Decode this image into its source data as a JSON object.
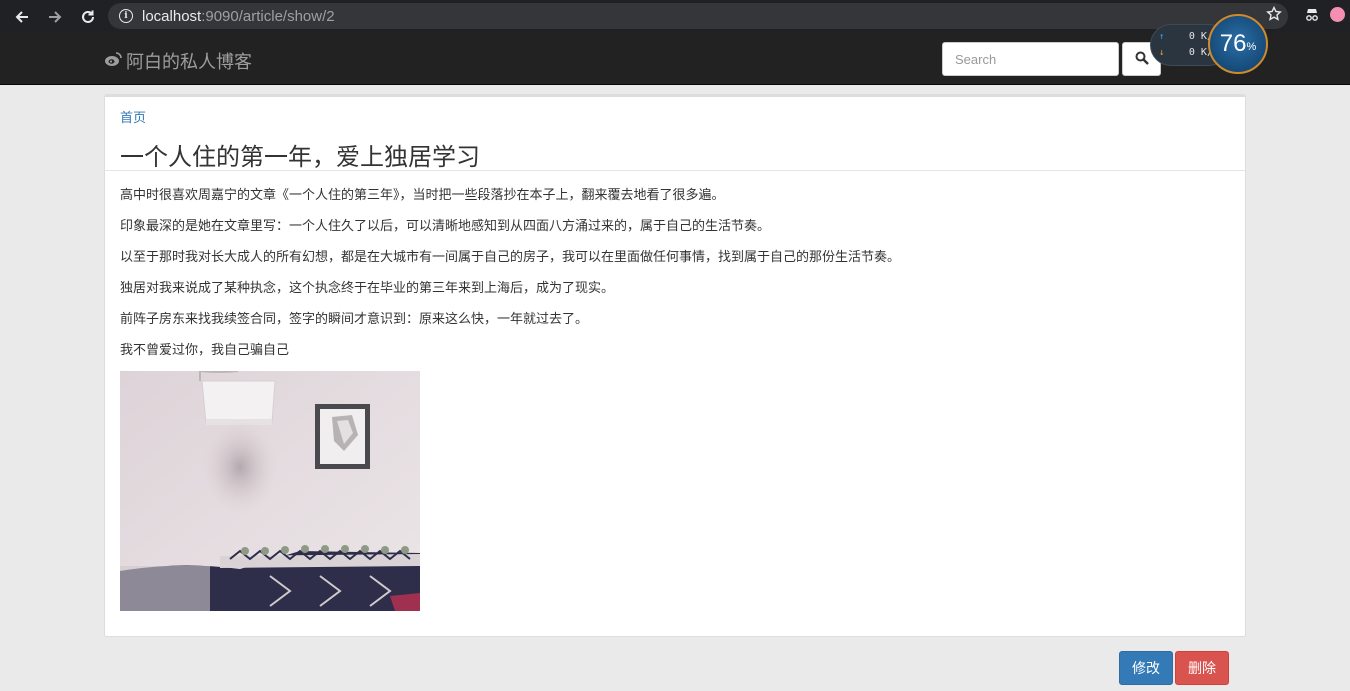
{
  "browser": {
    "url_host": "localhost",
    "url_rest": ":9090/article/show/2"
  },
  "navbar": {
    "brand": "阿白的私人博客",
    "search_placeholder": "Search"
  },
  "speed_widget": {
    "up": "0 K/s",
    "down": "0 K/s",
    "percent_num": "76",
    "percent_sign": "%"
  },
  "article": {
    "breadcrumb": "首页",
    "title": "一个人住的第一年，爱上独居学习",
    "paragraphs": [
      "高中时很喜欢周嘉宁的文章《一个人住的第三年》，当时把一些段落抄在本子上，翻来覆去地看了很多遍。",
      "印象最深的是她在文章里写：一个人住久了以后，可以清晰地感知到从四面八方涌过来的，属于自己的生活节奏。",
      "以至于那时我对长大成人的所有幻想，都是在大城市有一间属于自己的房子，我可以在里面做任何事情，找到属于自己的那份生活节奏。",
      "独居对我来说成了某种执念，这个执念终于在毕业的第三年来到上海后，成为了现实。",
      "前阵子房东来找我续签合同，签字的瞬间才意识到：原来这么快，一年就过去了。",
      "我不曾爱过你，我自己骗自己"
    ]
  },
  "actions": {
    "edit": "修改",
    "delete": "删除"
  },
  "colors": {
    "primary": "#337ab7",
    "danger": "#d9534f",
    "navbar": "#222222"
  }
}
